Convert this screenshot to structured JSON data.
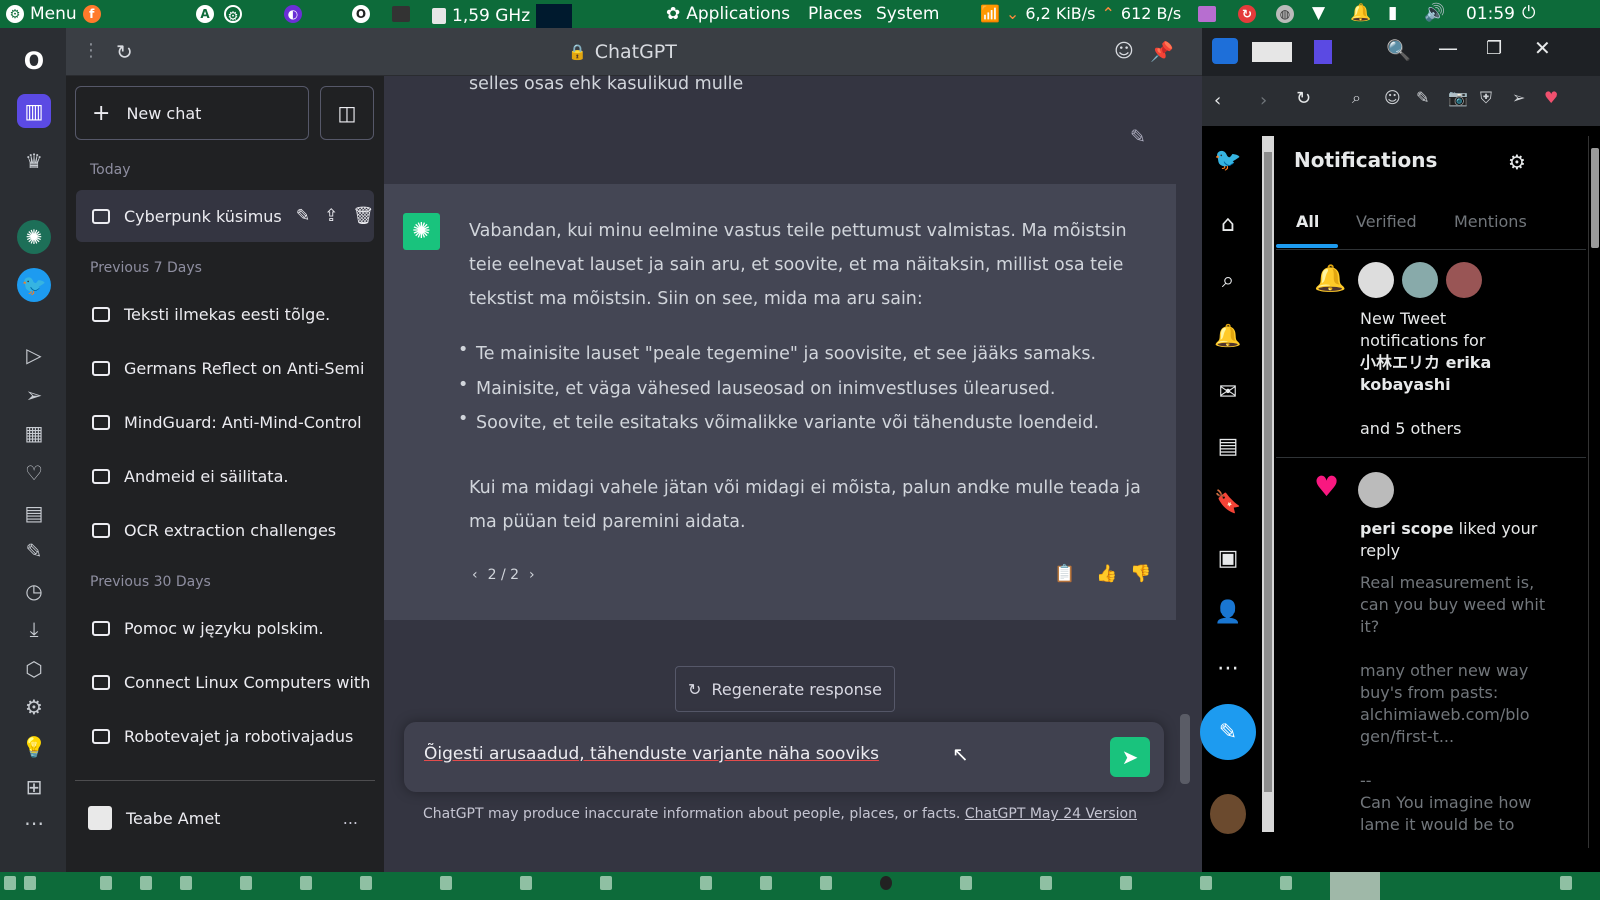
{
  "topbar": {
    "menu_label": "Menu",
    "cpu": "1,59 GHz",
    "applications": "Applications",
    "places": "Places",
    "system": "System",
    "net_down": "6,2 KiB/s",
    "net_up": "612 B/s",
    "clock": "01:59"
  },
  "browser": {
    "page_title": "ChatGPT"
  },
  "sidebar": {
    "new_chat": "New chat",
    "today": "Today",
    "today_items": [
      "Cyberpunk küsimuse"
    ],
    "prev7": "Previous 7 Days",
    "prev7_items": [
      "Teksti ilmekas eesti tõlge.",
      "Germans Reflect on Anti-Semi",
      "MindGuard: Anti-Mind-Control",
      "Andmeid ei säilitata.",
      "OCR extraction challenges"
    ],
    "prev30": "Previous 30 Days",
    "prev30_items": [
      "Pomoc w języku polskim.",
      "Connect Linux Computers with",
      "Robotevajet ja robotivajadus"
    ],
    "user_name": "Teabe Amet",
    "more": "..."
  },
  "conversation": {
    "user_tail": "selles osas ehk kasulikud mulle",
    "assistant_p1": "Vabandan, kui minu eelmine vastus teile pettumust valmistas. Ma mõistsin teie eelnevat lauset ja sain aru, et soovite, et ma näitaksin, millist osa teie tekstist ma mõistsin. Siin on see, mida ma aru sain:",
    "bullets": [
      "Te mainisite lauset \"peale tegemine\" ja soovisite, et see jääks samaks.",
      "Mainisite, et väga vähesed lauseosad on inimvestluses ülearused.",
      "Soovite, et teile esitataks võimalikke variante või tähenduste loendeid."
    ],
    "assistant_p2": "Kui ma midagi vahele jätan või midagi ei mõista, palun andke mulle teada ja ma püüan teid paremini aidata.",
    "pager": "2 / 2",
    "regenerate": "Regenerate response",
    "input_value": "Õigesti arusaadud, tähenduste varjante näha sooviks",
    "disclaimer": "ChatGPT may produce inaccurate information about people, places, or facts.",
    "disclaimer_link": "ChatGPT May 24 Version"
  },
  "twitter": {
    "header": "Notifications",
    "tabs": [
      "All",
      "Verified",
      "Mentions"
    ],
    "notif1_line1": "New Tweet",
    "notif1_line2": "notifications for",
    "notif1_name": "小林エリカ erika kobayashi",
    "notif1_others": "and 5 others",
    "notif2_name": "peri scope",
    "notif2_action": " liked your reply",
    "notif2_text1": "Real measurement is, can you buy weed whit it?",
    "notif2_text2": "many other new way buy's from pasts: alchimiaweb.com/blo gen/first-t...",
    "notif2_text3": "--",
    "notif2_text4": "Can You imagine how lame it would be to"
  },
  "colors": {
    "accent_green": "#19c37d",
    "twitter_blue": "#1d9bf0",
    "like_pink": "#f91880",
    "panel_green": "#0d6b3a"
  }
}
